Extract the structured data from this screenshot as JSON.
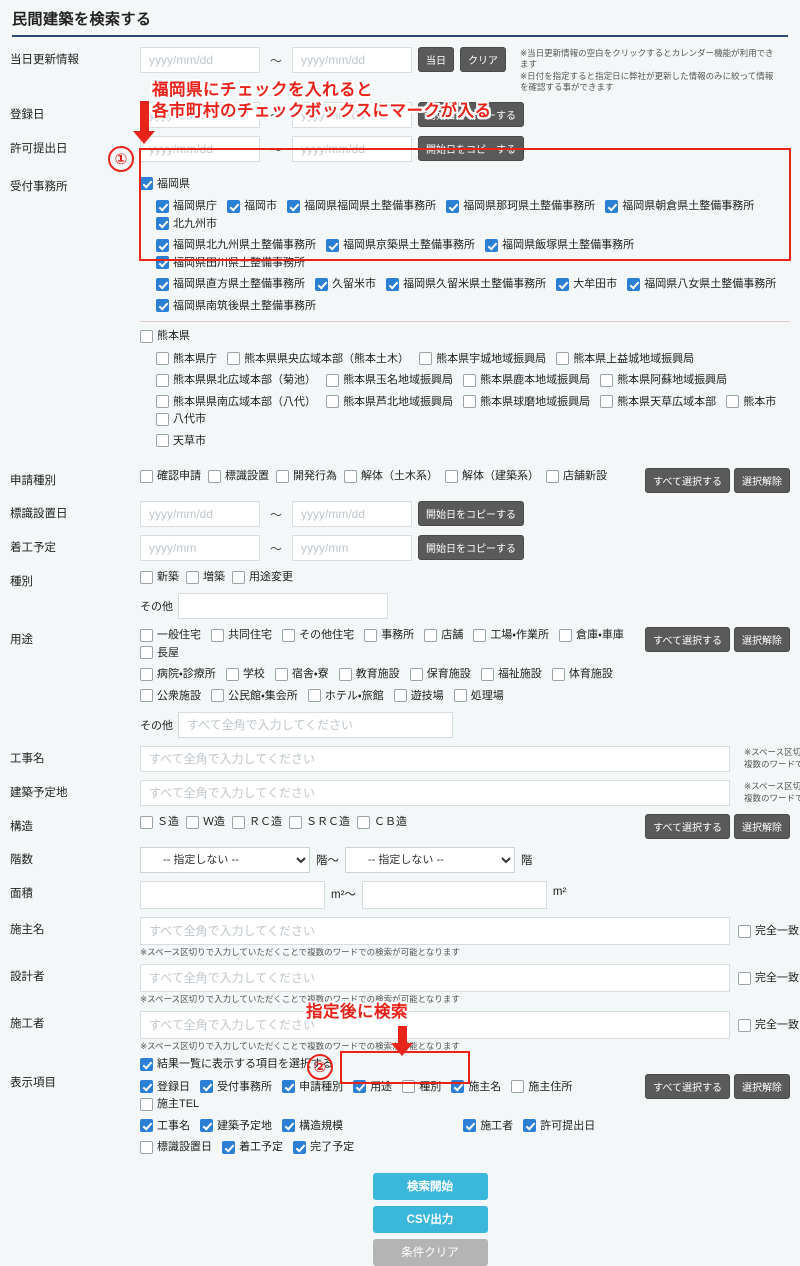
{
  "page": {
    "title": "民間建築を検索する"
  },
  "rows": {
    "update_info": {
      "label": "当日更新情報",
      "from_placeholder": "yyyy/mm/dd",
      "to_placeholder": "yyyy/mm/dd",
      "separator": "～",
      "today_button": "当日",
      "clear_button": "クリア",
      "note_line1": "※当日更新情報の空白をクリックするとカレンダー機能が利用できます",
      "note_line2": "※日付を指定すると指定日に弊社が更新した情報のみに絞って情報を確認する事ができます"
    },
    "registered_date": {
      "label": "登録日",
      "from_placeholder": "yyyy/mm/dd",
      "to_placeholder": "yyyy/mm/dd",
      "separator": "～",
      "copy_button": "開始日をコピーする"
    },
    "permit_date": {
      "label": "許可提出日",
      "from_placeholder": "yyyy/mm/dd",
      "to_placeholder": "yyyy/mm/dd",
      "separator": "～",
      "copy_button": "開始日をコピーする"
    },
    "office": {
      "label": "受付事務所",
      "prefectures": [
        {
          "name": "福岡県",
          "checked": true,
          "office_rows": [
            [
              {
                "label": "福岡県庁",
                "checked": true
              },
              {
                "label": "福岡市",
                "checked": true
              },
              {
                "label": "福岡県福岡県土整備事務所",
                "checked": true
              },
              {
                "label": "福岡県那珂県土整備事務所",
                "checked": true
              },
              {
                "label": "福岡県朝倉県土整備事務所",
                "checked": true
              },
              {
                "label": "北九州市",
                "checked": true
              }
            ],
            [
              {
                "label": "福岡県北九州県土整備事務所",
                "checked": true
              },
              {
                "label": "福岡県京築県土整備事務所",
                "checked": true
              },
              {
                "label": "福岡県飯塚県土整備事務所",
                "checked": true
              },
              {
                "label": "福岡県田川県土整備事務所",
                "checked": true
              }
            ],
            [
              {
                "label": "福岡県直方県土整備事務所",
                "checked": true
              },
              {
                "label": "久留米市",
                "checked": true
              },
              {
                "label": "福岡県久留米県土整備事務所",
                "checked": true
              },
              {
                "label": "大牟田市",
                "checked": true
              },
              {
                "label": "福岡県八女県土整備事務所",
                "checked": true
              }
            ],
            [
              {
                "label": "福岡県南筑後県土整備事務所",
                "checked": true
              }
            ]
          ]
        },
        {
          "name": "熊本県",
          "checked": false,
          "office_rows": [
            [
              {
                "label": "熊本県庁",
                "checked": false
              },
              {
                "label": "熊本県県央広域本部（熊本土木）",
                "checked": false
              },
              {
                "label": "熊本県宇城地域振興局",
                "checked": false
              },
              {
                "label": "熊本県上益城地域振興局",
                "checked": false
              }
            ],
            [
              {
                "label": "熊本県県北広域本部（菊池）",
                "checked": false
              },
              {
                "label": "熊本県玉名地域振興局",
                "checked": false
              },
              {
                "label": "熊本県鹿本地域振興局",
                "checked": false
              },
              {
                "label": "熊本県阿蘇地域振興局",
                "checked": false
              }
            ],
            [
              {
                "label": "熊本県県南広域本部（八代）",
                "checked": false
              },
              {
                "label": "熊本県芦北地域振興局",
                "checked": false
              },
              {
                "label": "熊本県球磨地域振興局",
                "checked": false
              },
              {
                "label": "熊本県天草広域本部",
                "checked": false
              },
              {
                "label": "熊本市",
                "checked": false
              },
              {
                "label": "八代市",
                "checked": false
              }
            ],
            [
              {
                "label": "天草市",
                "checked": false
              }
            ]
          ]
        }
      ]
    },
    "application_type": {
      "label": "申請種別",
      "items": [
        {
          "label": "確認申請",
          "checked": false
        },
        {
          "label": "標識設置",
          "checked": false
        },
        {
          "label": "開発行為",
          "checked": false
        },
        {
          "label": "解体（土木系）",
          "checked": false
        },
        {
          "label": "解体（建築系）",
          "checked": false
        },
        {
          "label": "店舗新設",
          "checked": false
        }
      ],
      "select_all": "すべて選択する",
      "deselect": "選択解除"
    },
    "sign_date": {
      "label": "標識設置日",
      "from_placeholder": "yyyy/mm/dd",
      "to_placeholder": "yyyy/mm/dd",
      "separator": "～",
      "copy_button": "開始日をコピーする"
    },
    "start_plan": {
      "label": "着工予定",
      "from_placeholder": "yyyy/mm",
      "to_placeholder": "yyyy/mm",
      "separator": "～",
      "copy_button": "開始日をコピーする"
    },
    "category": {
      "label": "種別",
      "items": [
        {
          "label": "新築",
          "checked": false
        },
        {
          "label": "増築",
          "checked": false
        },
        {
          "label": "用途変更",
          "checked": false
        }
      ],
      "other_label": "その他",
      "other_value": ""
    },
    "usage": {
      "label": "用途",
      "rows": [
        [
          {
            "label": "一般住宅",
            "checked": false
          },
          {
            "label": "共同住宅",
            "checked": false
          },
          {
            "label": "その他住宅",
            "checked": false
          },
          {
            "label": "事務所",
            "checked": false
          },
          {
            "label": "店舗",
            "checked": false
          },
          {
            "label": "工場・作業所",
            "checked": false
          },
          {
            "label": "倉庫・車庫",
            "checked": false
          },
          {
            "label": "長屋",
            "checked": false
          }
        ],
        [
          {
            "label": "病院・診療所",
            "checked": false
          },
          {
            "label": "学校",
            "checked": false
          },
          {
            "label": "宿舎・寮",
            "checked": false
          },
          {
            "label": "教育施設",
            "checked": false
          },
          {
            "label": "保育施設",
            "checked": false
          },
          {
            "label": "福祉施設",
            "checked": false
          },
          {
            "label": "体育施設",
            "checked": false
          }
        ],
        [
          {
            "label": "公衆施設",
            "checked": false
          },
          {
            "label": "公民館・集会所",
            "checked": false
          },
          {
            "label": "ホテル・旅館",
            "checked": false
          },
          {
            "label": "遊技場",
            "checked": false
          },
          {
            "label": "処理場",
            "checked": false
          }
        ]
      ],
      "select_all": "すべて選択する",
      "deselect": "選択解除",
      "other_label": "その他",
      "other_placeholder": "すべて全角で入力してください"
    },
    "work_name": {
      "label": "工事名",
      "placeholder": "すべて全角で入力してください",
      "note": "※スペース区切りで入力していただくことで複数のワードでの検索が可能となります"
    },
    "build_site": {
      "label": "建築予定地",
      "placeholder": "すべて全角で入力してください",
      "note": "※スペース区切りで入力していただくことで複数のワードでの検索が可能となります"
    },
    "structure": {
      "label": "構造",
      "items": [
        {
          "label": "Ｓ造",
          "checked": false
        },
        {
          "label": "Ｗ造",
          "checked": false
        },
        {
          "label": "ＲＣ造",
          "checked": false
        },
        {
          "label": "ＳＲＣ造",
          "checked": false
        },
        {
          "label": "ＣＢ造",
          "checked": false
        }
      ],
      "select_all": "すべて選択する",
      "deselect": "選択解除"
    },
    "floors": {
      "label": "階数",
      "from_value": "-- 指定しない --",
      "to_value": "-- 指定しない --",
      "unit_from": "階～",
      "unit_to": "階"
    },
    "area": {
      "label": "面積",
      "from_value": "",
      "to_value": "",
      "unit_from": "m²～",
      "unit_to": "m²"
    },
    "owner": {
      "label": "施主名",
      "placeholder": "すべて全角で入力してください",
      "exact_label": "完全一致",
      "exact_checked": false,
      "note": "※スペース区切りで入力していただくことで複数のワードでの検索が可能となります"
    },
    "designer": {
      "label": "設計者",
      "placeholder": "すべて全角で入力してください",
      "exact_label": "完全一致",
      "exact_checked": false,
      "note": "※スペース区切りで入力していただくことで複数のワードでの検索が可能となります"
    },
    "builder": {
      "label": "施工者",
      "placeholder": "すべて全角で入力してください",
      "exact_label": "完全一致",
      "exact_checked": false,
      "note": "※スペース区切りで入力していただくことで複数のワードでの検索が可能となります"
    },
    "display_items": {
      "label": "表示項目",
      "master_label": "結果一覧に表示する項目を選択する",
      "master_checked": true,
      "rows": [
        [
          {
            "label": "登録日",
            "checked": true
          },
          {
            "label": "受付事務所",
            "checked": true
          },
          {
            "label": "申請種別",
            "checked": true
          },
          {
            "label": "用途",
            "checked": true
          },
          {
            "label": "種別",
            "checked": false
          },
          {
            "label": "施主名",
            "checked": true
          },
          {
            "label": "施主住所",
            "checked": false
          },
          {
            "label": "施主TEL",
            "checked": false
          }
        ],
        [
          {
            "label": "工事名",
            "checked": true
          },
          {
            "label": "建築予定地",
            "checked": true
          },
          {
            "label": "構造規模",
            "checked": true
          },
          {
            "label": "施工者",
            "checked": true
          },
          {
            "label": "許可提出日",
            "checked": true
          }
        ],
        [
          {
            "label": "標識設置日",
            "checked": false
          },
          {
            "label": "着工予定",
            "checked": true
          },
          {
            "label": "完了予定",
            "checked": true
          }
        ]
      ],
      "select_all": "すべて選択する",
      "deselect": "選択解除"
    }
  },
  "actions": {
    "search": "検索開始",
    "csv": "CSV出力",
    "clear": "条件クリア"
  },
  "annotations": {
    "note1_line1": "福岡県にチェックを入れると",
    "note1_line2": "各市町村のチェックボックスにマークが入る",
    "step1": "①",
    "note2": "指定後に検索",
    "step2": "②"
  },
  "colors": {
    "accent_blue": "#2b7fd4",
    "cyan_button": "#3bb7db",
    "annotation_red": "#e8231a",
    "title_rule": "#2b4a73"
  }
}
